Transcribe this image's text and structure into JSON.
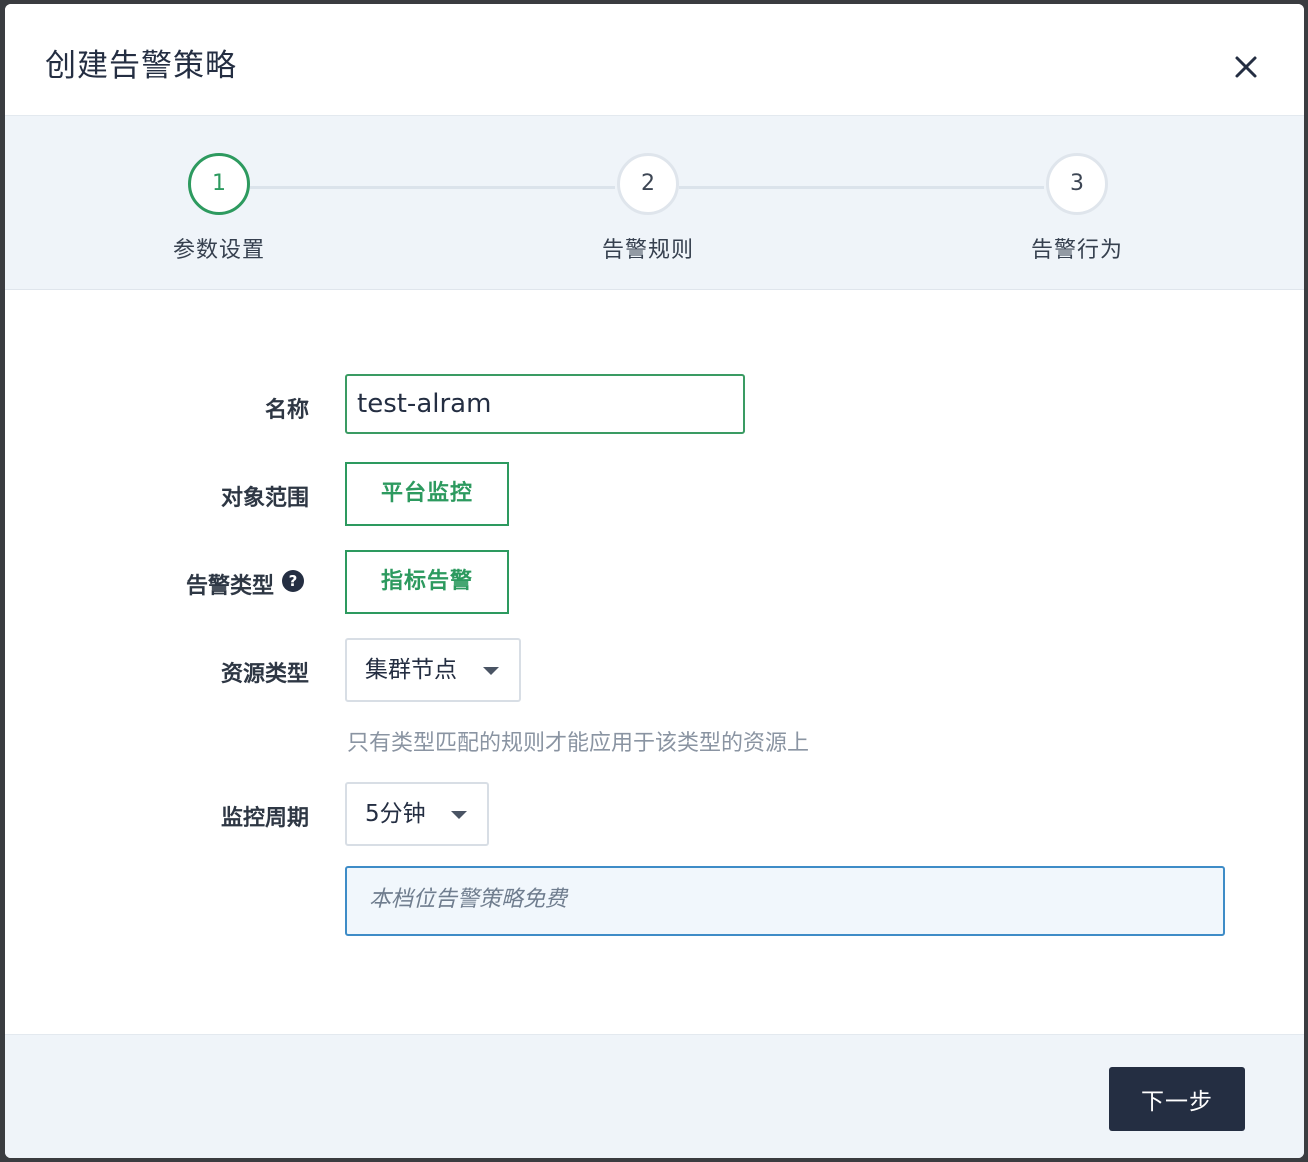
{
  "dialog": {
    "title": "创建告警策略",
    "close_icon": "close-icon"
  },
  "steps": [
    {
      "number": "1",
      "label": "参数设置",
      "active": true
    },
    {
      "number": "2",
      "label": "告警规则",
      "active": false
    },
    {
      "number": "3",
      "label": "告警行为",
      "active": false
    }
  ],
  "form": {
    "name": {
      "label": "名称",
      "value": "test-alram"
    },
    "scope": {
      "label": "对象范围",
      "value": "平台监控"
    },
    "alert_type": {
      "label": "告警类型",
      "value": "指标告警",
      "help_icon": "question-circle-icon"
    },
    "resource_type": {
      "label": "资源类型",
      "value": "集群节点",
      "hint": "只有类型匹配的规则才能应用于该类型的资源上"
    },
    "period": {
      "label": "监控周期",
      "value": "5分钟"
    },
    "notice": "本档位告警策略免费"
  },
  "footer": {
    "next_label": "下一步"
  },
  "colors": {
    "accent": "#2d9a5f",
    "dark": "#242e42",
    "info_border": "#3e8cc7"
  }
}
